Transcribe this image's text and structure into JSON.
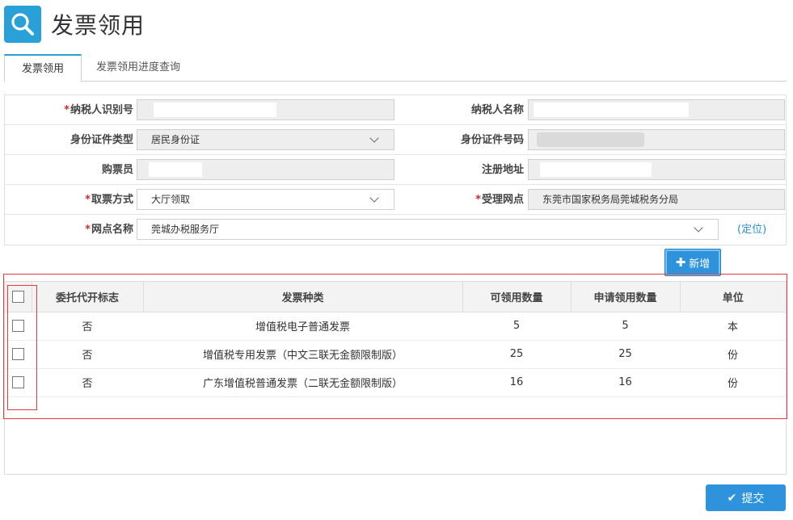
{
  "header": {
    "title": "发票领用",
    "icon": "search-icon",
    "accent": "#2aa0d8"
  },
  "tabs": [
    {
      "label": "发票领用",
      "active": true
    },
    {
      "label": "发票领用进度查询",
      "active": false
    }
  ],
  "form": {
    "taxpayer_id": {
      "label": "纳税人识别号",
      "required": true,
      "value": ""
    },
    "taxpayer_name": {
      "label": "纳税人名称",
      "required": false,
      "value": ""
    },
    "id_type": {
      "label": "身份证件类型",
      "required": false,
      "value": "居民身份证"
    },
    "id_number": {
      "label": "身份证件号码",
      "required": false,
      "value": ""
    },
    "buyer": {
      "label": "购票员",
      "required": false,
      "value": ""
    },
    "reg_address": {
      "label": "注册地址",
      "required": false,
      "value": ""
    },
    "pickup_method": {
      "label": "取票方式",
      "required": true,
      "value": "大厅领取"
    },
    "accept_point": {
      "label": "受理网点",
      "required": true,
      "value": "东莞市国家税务局莞城税务分局"
    },
    "point_name": {
      "label": "网点名称",
      "required": true,
      "value": "莞城办税服务厅"
    },
    "locate_link": "(定位)"
  },
  "toolbar": {
    "add_label": "新增",
    "submit_label": "提交"
  },
  "table": {
    "headers": [
      "委托代开标志",
      "发票种类",
      "可领用数量",
      "申请领用数量",
      "单位"
    ],
    "rows": [
      {
        "flag": "否",
        "type": "增值税电子普通发票",
        "available": "5",
        "requested": "5",
        "unit": "本"
      },
      {
        "flag": "否",
        "type": "增值税专用发票（中文三联无金额限制版）",
        "available": "25",
        "requested": "25",
        "unit": "份"
      },
      {
        "flag": "否",
        "type": "广东增值税普通发票（二联无金额限制版）",
        "available": "16",
        "requested": "16",
        "unit": "份"
      }
    ]
  }
}
